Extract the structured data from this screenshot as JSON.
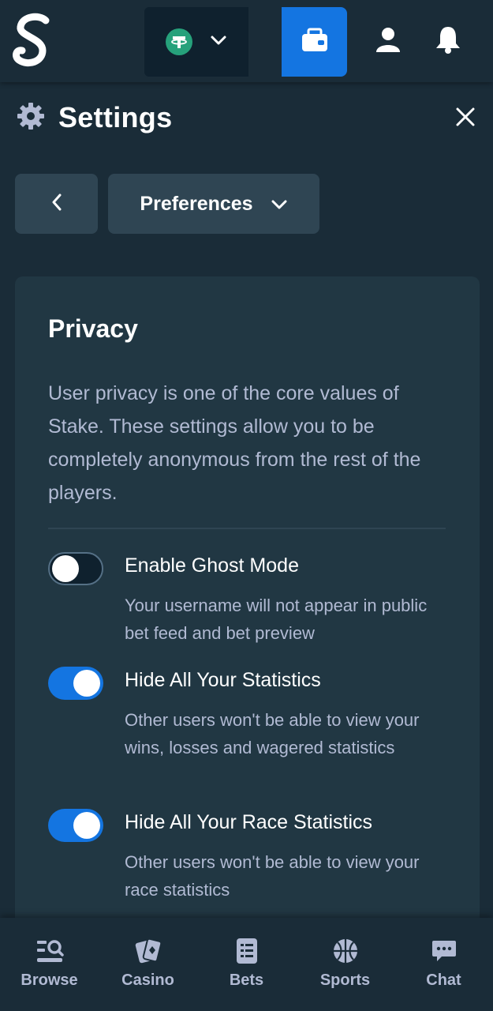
{
  "app": {
    "logo_letter": "S",
    "logo_icon": "stake-logo-icon"
  },
  "topbar": {
    "currency_icon": "tether-icon",
    "wallet_icon": "wallet-icon",
    "user_icon": "user-icon",
    "notifications_icon": "bell-icon"
  },
  "settings": {
    "title": "Settings",
    "icon": "gear-icon",
    "close_icon": "close-icon",
    "back_icon": "chevron-left-icon",
    "section_dropdown": "Preferences"
  },
  "privacy": {
    "title": "Privacy",
    "description": "User privacy is one of the core values of Stake. These settings allow you to be completely anonymous from the rest of the players.",
    "options": [
      {
        "label": "Enable Ghost Mode",
        "description": "Your username will not appear in public bet feed and bet preview",
        "enabled": false
      },
      {
        "label": "Hide All Your Statistics",
        "description": "Other users won't be able to view your wins, losses and wagered statistics",
        "enabled": true
      },
      {
        "label": "Hide All Your Race Statistics",
        "description": "Other users won't be able to view your race statistics",
        "enabled": true
      }
    ]
  },
  "bottom_nav": {
    "items": [
      {
        "label": "Browse",
        "icon": "browse-icon"
      },
      {
        "label": "Casino",
        "icon": "casino-cards-icon"
      },
      {
        "label": "Bets",
        "icon": "bets-list-icon"
      },
      {
        "label": "Sports",
        "icon": "basketball-icon"
      },
      {
        "label": "Chat",
        "icon": "chat-icon"
      }
    ]
  },
  "colors": {
    "background": "#1a2c38",
    "card": "#213743",
    "accent_blue": "#1475e1",
    "muted_text": "#b1bad3",
    "tether_green": "#26a17b"
  }
}
